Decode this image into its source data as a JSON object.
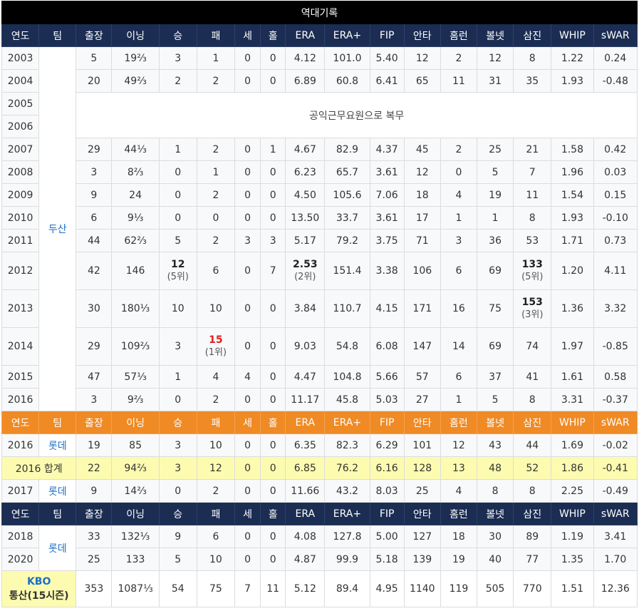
{
  "title": "역대기록",
  "columns": [
    "연도",
    "팀",
    "출장",
    "이닝",
    "승",
    "패",
    "세",
    "홀",
    "ERA",
    "ERA+",
    "FIP",
    "안타",
    "홈런",
    "볼넷",
    "삼진",
    "WHIP",
    "sWAR"
  ],
  "team_doosan": "두산",
  "team_lotte": "롯데",
  "note_2005_2006": "공익근무요원으로 복무",
  "doosan_rows": [
    {
      "year": "2003",
      "g": "5",
      "ip": "19⅔",
      "w": "3",
      "l": "1",
      "sv": "0",
      "hld": "0",
      "era": "4.12",
      "era_plus": "101.0",
      "fip": "5.40",
      "h": "12",
      "hr": "2",
      "bb": "12",
      "so": "8",
      "whip": "1.22",
      "swar": "0.24"
    },
    {
      "year": "2004",
      "g": "20",
      "ip": "49⅔",
      "w": "2",
      "l": "2",
      "sv": "0",
      "hld": "0",
      "era": "6.89",
      "era_plus": "60.8",
      "fip": "6.41",
      "h": "65",
      "hr": "11",
      "bb": "31",
      "so": "35",
      "whip": "1.93",
      "swar": "-0.48"
    },
    {
      "year": "2005"
    },
    {
      "year": "2006"
    },
    {
      "year": "2007",
      "g": "29",
      "ip": "44⅓",
      "w": "1",
      "l": "2",
      "sv": "0",
      "hld": "1",
      "era": "4.67",
      "era_plus": "82.9",
      "fip": "4.37",
      "h": "45",
      "hr": "2",
      "bb": "25",
      "so": "21",
      "whip": "1.58",
      "swar": "0.42"
    },
    {
      "year": "2008",
      "g": "3",
      "ip": "8⅔",
      "w": "0",
      "l": "1",
      "sv": "0",
      "hld": "0",
      "era": "6.23",
      "era_plus": "65.7",
      "fip": "3.61",
      "h": "12",
      "hr": "0",
      "bb": "5",
      "so": "7",
      "whip": "1.96",
      "swar": "0.03"
    },
    {
      "year": "2009",
      "g": "9",
      "ip": "24",
      "w": "0",
      "l": "2",
      "sv": "0",
      "hld": "0",
      "era": "4.50",
      "era_plus": "105.6",
      "fip": "7.06",
      "h": "18",
      "hr": "4",
      "bb": "19",
      "so": "11",
      "whip": "1.54",
      "swar": "0.15"
    },
    {
      "year": "2010",
      "g": "6",
      "ip": "9⅓",
      "w": "0",
      "l": "0",
      "sv": "0",
      "hld": "0",
      "era": "13.50",
      "era_plus": "33.7",
      "fip": "3.61",
      "h": "17",
      "hr": "1",
      "bb": "1",
      "so": "8",
      "whip": "1.93",
      "swar": "-0.10"
    },
    {
      "year": "2011",
      "g": "44",
      "ip": "62⅔",
      "w": "5",
      "l": "2",
      "sv": "3",
      "hld": "3",
      "era": "5.17",
      "era_plus": "79.2",
      "fip": "3.75",
      "h": "71",
      "hr": "3",
      "bb": "36",
      "so": "53",
      "whip": "1.71",
      "swar": "0.73"
    },
    {
      "year": "2012",
      "g": "42",
      "ip": "146",
      "w": "12",
      "w_rank": "(5위)",
      "l": "6",
      "sv": "0",
      "hld": "7",
      "era": "2.53",
      "era_rank": "(2위)",
      "era_plus": "151.4",
      "fip": "3.38",
      "h": "106",
      "hr": "6",
      "bb": "69",
      "so": "133",
      "so_rank": "(5위)",
      "whip": "1.20",
      "swar": "4.11"
    },
    {
      "year": "2013",
      "g": "30",
      "ip": "180⅓",
      "w": "10",
      "l": "10",
      "sv": "0",
      "hld": "0",
      "era": "3.84",
      "era_plus": "110.7",
      "fip": "4.15",
      "h": "171",
      "hr": "16",
      "bb": "75",
      "so": "153",
      "so_rank": "(3위)",
      "whip": "1.36",
      "swar": "3.32"
    },
    {
      "year": "2014",
      "g": "29",
      "ip": "109⅔",
      "w": "3",
      "l": "15",
      "l_rank": "(1위)",
      "sv": "0",
      "hld": "0",
      "era": "9.03",
      "era_plus": "54.8",
      "fip": "6.08",
      "h": "147",
      "hr": "14",
      "bb": "69",
      "so": "74",
      "whip": "1.97",
      "swar": "-0.85"
    },
    {
      "year": "2015",
      "g": "47",
      "ip": "57⅓",
      "w": "1",
      "l": "4",
      "sv": "4",
      "hld": "0",
      "era": "4.47",
      "era_plus": "104.8",
      "fip": "5.66",
      "h": "57",
      "hr": "6",
      "bb": "37",
      "so": "41",
      "whip": "1.61",
      "swar": "0.58"
    },
    {
      "year": "2016",
      "g": "3",
      "ip": "9⅔",
      "w": "0",
      "l": "2",
      "sv": "0",
      "hld": "0",
      "era": "11.17",
      "era_plus": "45.8",
      "fip": "5.03",
      "h": "27",
      "hr": "1",
      "bb": "5",
      "so": "8",
      "whip": "3.31",
      "swar": "-0.37"
    }
  ],
  "lotte_2016": {
    "year": "2016",
    "g": "19",
    "ip": "85",
    "w": "3",
    "l": "10",
    "sv": "0",
    "hld": "0",
    "era": "6.35",
    "era_plus": "82.3",
    "fip": "6.29",
    "h": "101",
    "hr": "12",
    "bb": "43",
    "so": "44",
    "whip": "1.69",
    "swar": "-0.02"
  },
  "total_2016": {
    "label": "2016 합계",
    "g": "22",
    "ip": "94⅔",
    "w": "3",
    "l": "12",
    "sv": "0",
    "hld": "0",
    "era": "6.85",
    "era_plus": "76.2",
    "fip": "6.16",
    "h": "128",
    "hr": "13",
    "bb": "48",
    "so": "52",
    "whip": "1.86",
    "swar": "-0.41"
  },
  "lotte_2017": {
    "year": "2017",
    "g": "9",
    "ip": "14⅔",
    "w": "0",
    "l": "2",
    "sv": "0",
    "hld": "0",
    "era": "11.66",
    "era_plus": "43.2",
    "fip": "8.03",
    "h": "25",
    "hr": "4",
    "bb": "8",
    "so": "8",
    "whip": "2.25",
    "swar": "-0.49"
  },
  "lotte_late": [
    {
      "year": "2018",
      "g": "33",
      "ip": "132⅓",
      "w": "9",
      "l": "6",
      "sv": "0",
      "hld": "0",
      "era": "4.08",
      "era_plus": "127.8",
      "fip": "5.00",
      "h": "127",
      "hr": "18",
      "bb": "30",
      "so": "89",
      "whip": "1.19",
      "swar": "3.41"
    },
    {
      "year": "2020",
      "g": "25",
      "ip": "133",
      "w": "5",
      "l": "10",
      "sv": "0",
      "hld": "0",
      "era": "4.87",
      "era_plus": "99.9",
      "fip": "5.18",
      "h": "139",
      "hr": "19",
      "bb": "40",
      "so": "77",
      "whip": "1.35",
      "swar": "1.70"
    }
  ],
  "career": {
    "label_1": "KBO",
    "label_2": "통산(15시즌)",
    "g": "353",
    "ip": "1087⅓",
    "w": "54",
    "l": "75",
    "sv": "7",
    "hld": "11",
    "era": "5.12",
    "era_plus": "89.4",
    "fip": "4.95",
    "h": "1140",
    "hr": "119",
    "bb": "505",
    "so": "770",
    "whip": "1.51",
    "swar": "12.36"
  },
  "colors": {
    "navy": "#1b2d52",
    "orange": "#f08a24",
    "yellow": "#fdfbb0",
    "team_blue": "#1f6fc5",
    "highlight_red": "#e02020"
  }
}
